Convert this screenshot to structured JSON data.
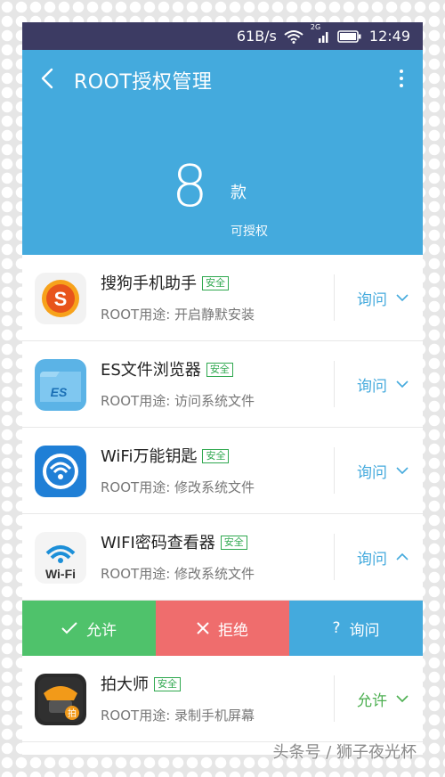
{
  "statusbar": {
    "speed": "61B/s",
    "time": "12:49",
    "network": "2G"
  },
  "header": {
    "title": "ROOT授权管理",
    "count": "8",
    "count_unit": "款",
    "count_sub": "可授权"
  },
  "apps": [
    {
      "name": "搜狗手机助手",
      "badge": "安全",
      "desc": "ROOT用途: 开启静默安装",
      "action": "询问"
    },
    {
      "name": "ES文件浏览器",
      "badge": "安全",
      "desc": "ROOT用途: 访问系统文件",
      "action": "询问"
    },
    {
      "name": "WiFi万能钥匙",
      "badge": "安全",
      "desc": "ROOT用途: 修改系统文件",
      "action": "询问"
    },
    {
      "name": "WIFI密码查看器",
      "badge": "安全",
      "desc": "ROOT用途: 修改系统文件",
      "action": "询问"
    },
    {
      "name": "拍大师",
      "badge": "安全",
      "desc": "ROOT用途: 录制手机屏幕",
      "action": "允许"
    }
  ],
  "action_bar": {
    "allow": "允许",
    "deny": "拒绝",
    "ask": "询问"
  },
  "icon_texts": {
    "es": "ES",
    "wifi": "Wi-Fi",
    "paidashi": "拍"
  },
  "watermark": "头条号 / 狮子夜光杯",
  "colors": {
    "header": "#44aadd",
    "statusbar": "#3c3b63",
    "allow": "#4fc26b",
    "deny": "#ef6d6d",
    "ask": "#44aadd",
    "safe_badge": "#2fa84f"
  }
}
